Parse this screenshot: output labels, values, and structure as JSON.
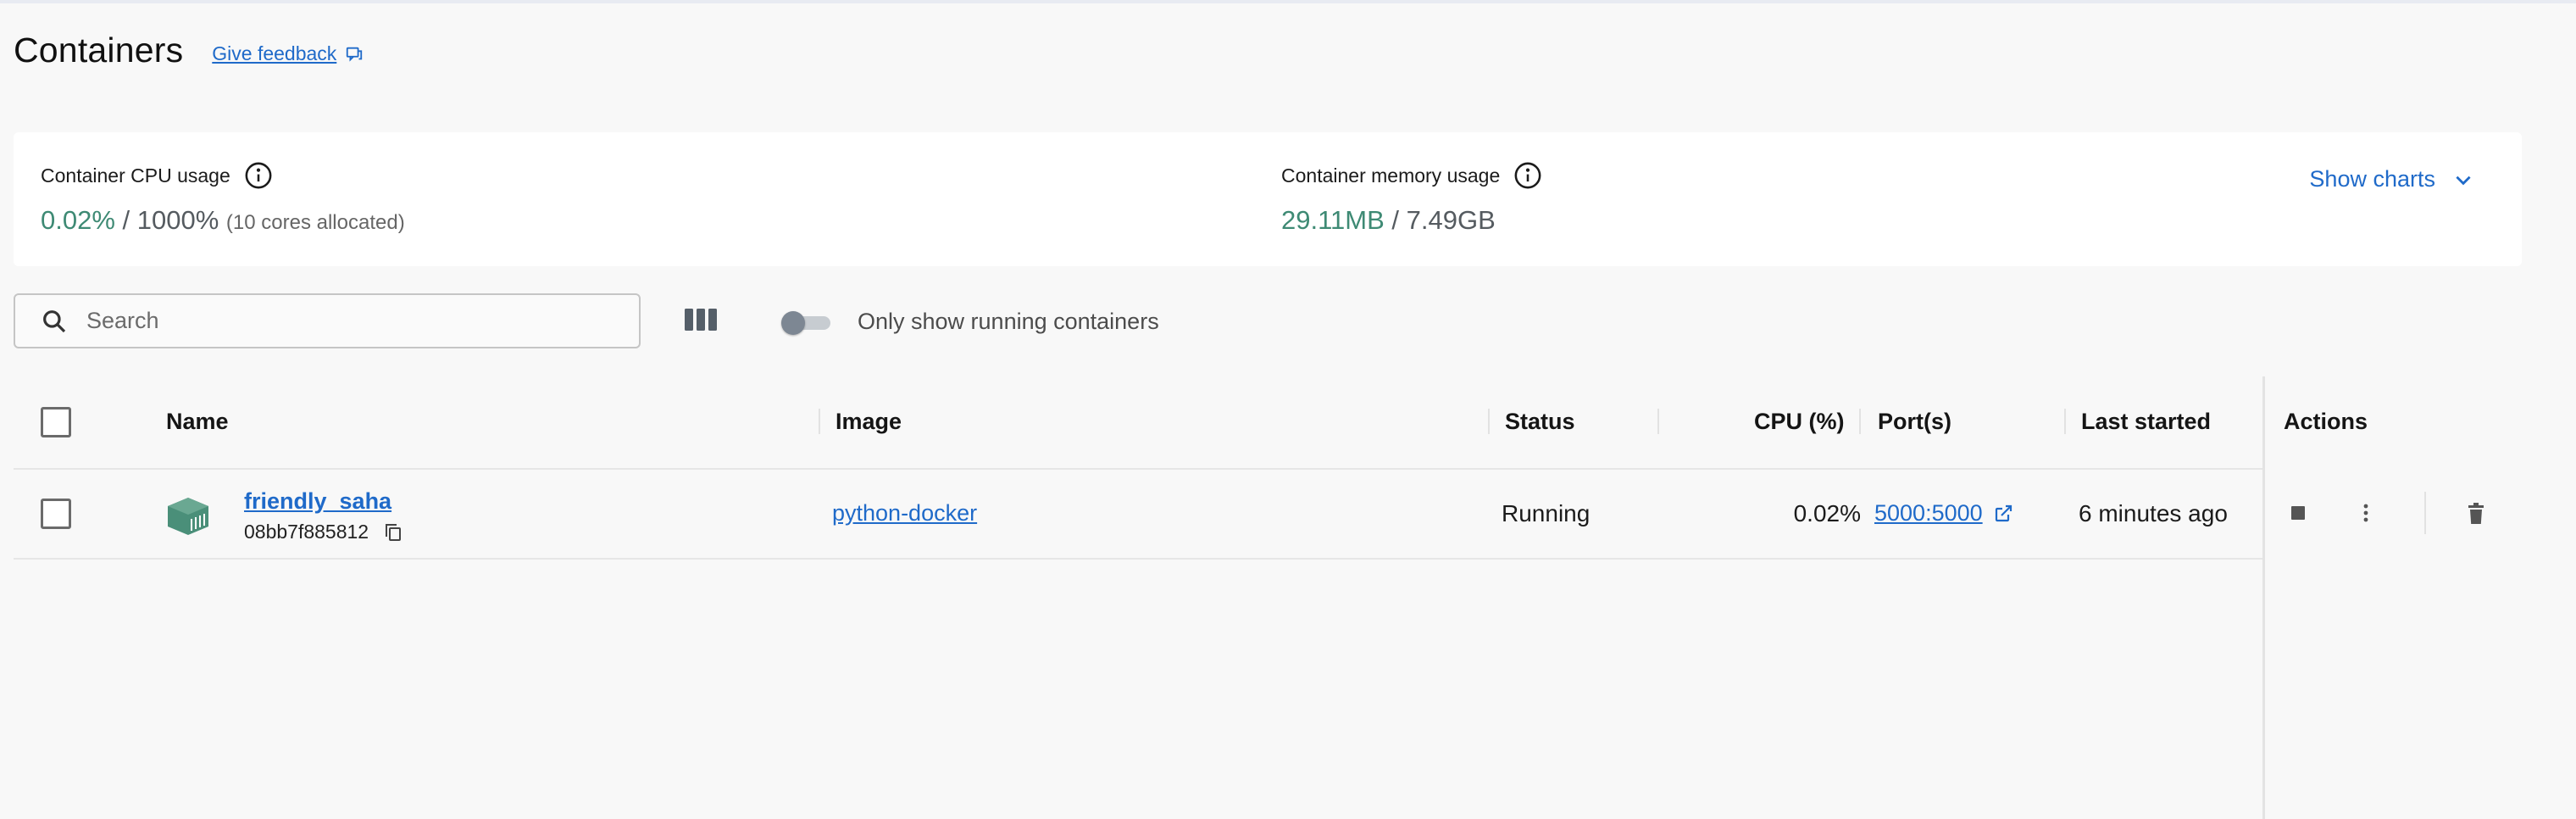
{
  "page": {
    "title": "Containers",
    "feedback_label": "Give feedback"
  },
  "usage": {
    "cpu": {
      "label": "Container CPU usage",
      "used": "0.02%",
      "separator": " / ",
      "total": "1000%",
      "note": "(10 cores allocated)"
    },
    "memory": {
      "label": "Container memory usage",
      "used": "29.11MB",
      "separator": " / ",
      "total": "7.49GB"
    },
    "show_charts_label": "Show charts"
  },
  "toolbar": {
    "search_placeholder": "Search",
    "toggle_label": "Only show running containers",
    "toggle_on": false
  },
  "table": {
    "headers": {
      "name": "Name",
      "image": "Image",
      "status": "Status",
      "cpu": "CPU (%)",
      "ports": "Port(s)",
      "last_started": "Last started",
      "actions": "Actions"
    },
    "rows": [
      {
        "name": "friendly_saha",
        "id": "08bb7f885812",
        "image": "python-docker",
        "status": "Running",
        "cpu": "0.02%",
        "ports": "5000:5000",
        "last_started": "6 minutes ago",
        "icon": "container-icon",
        "icon_color": "#4a8f79"
      }
    ]
  },
  "colors": {
    "link": "#1f6ac9",
    "usage_green": "#3e8a74",
    "background": "#f8f8f8"
  }
}
